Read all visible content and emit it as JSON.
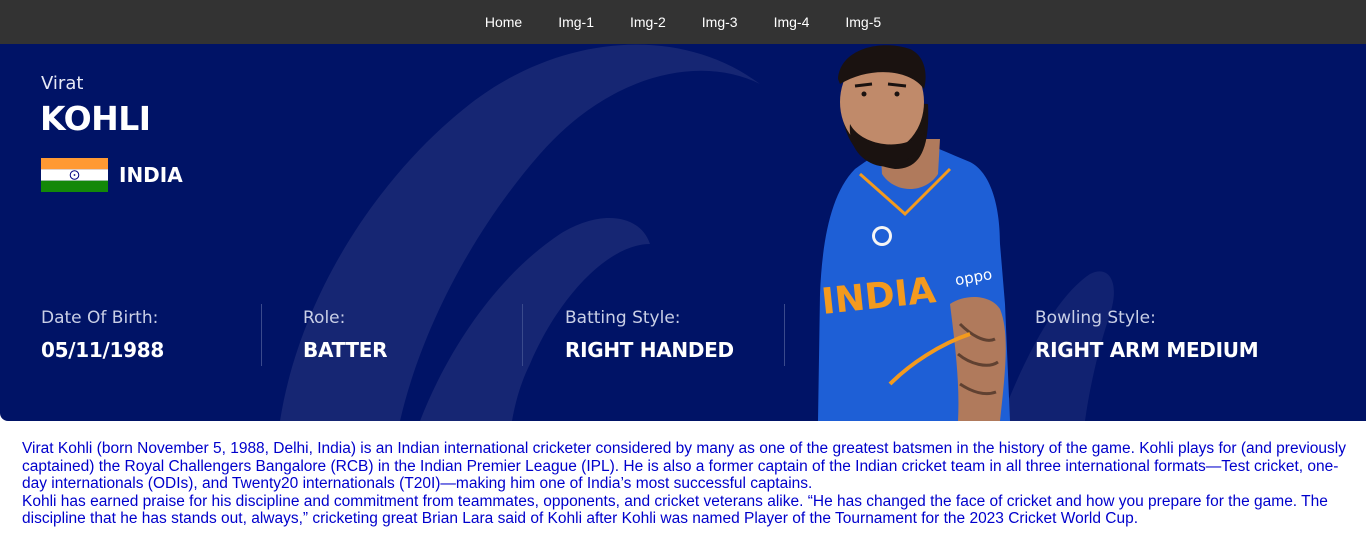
{
  "nav": {
    "items": [
      "Home",
      "Img-1",
      "Img-2",
      "Img-3",
      "Img-4",
      "Img-5"
    ]
  },
  "player": {
    "first_name": "Virat",
    "last_name": "KOHLI",
    "country": "INDIA",
    "stats": [
      {
        "label": "Date Of Birth:",
        "value": "05/11/1988"
      },
      {
        "label": "Role:",
        "value": "BATTER"
      },
      {
        "label": "Batting Style:",
        "value": "RIGHT HANDED"
      },
      {
        "label": "Bowling Style:",
        "value": "RIGHT ARM MEDIUM"
      }
    ]
  },
  "photo": {
    "jersey_text": "INDIA",
    "sponsor_text": "oppo"
  },
  "bio": {
    "paragraph_1": "Virat Kohli (born November 5, 1988, Delhi, India) is an Indian international cricketer considered by many as one of the greatest batsmen in the history of the game. Kohli plays for (and previously captained) the Royal Challengers Bangalore (RCB) in the Indian Premier League (IPL). He is also a former captain of the Indian cricket team in all three international formats—Test cricket, one-day internationals (ODIs), and Twenty20 internationals (T20I)—making him one of India’s most successful captains.",
    "paragraph_2": "Kohli has earned praise for his discipline and commitment from teammates, opponents, and cricket veterans alike. “He has changed the face of cricket and how you prepare for the game. The discipline that he has stands out, always,” cricketing great Brian Lara said of Kohli after Kohli was named Player of the Tournament for the 2023 Cricket World Cup."
  },
  "colors": {
    "nav_bg": "#333333",
    "hero_bg": "#001366",
    "bio_text": "#0000cc",
    "jersey_blue": "#1e5fd6"
  }
}
